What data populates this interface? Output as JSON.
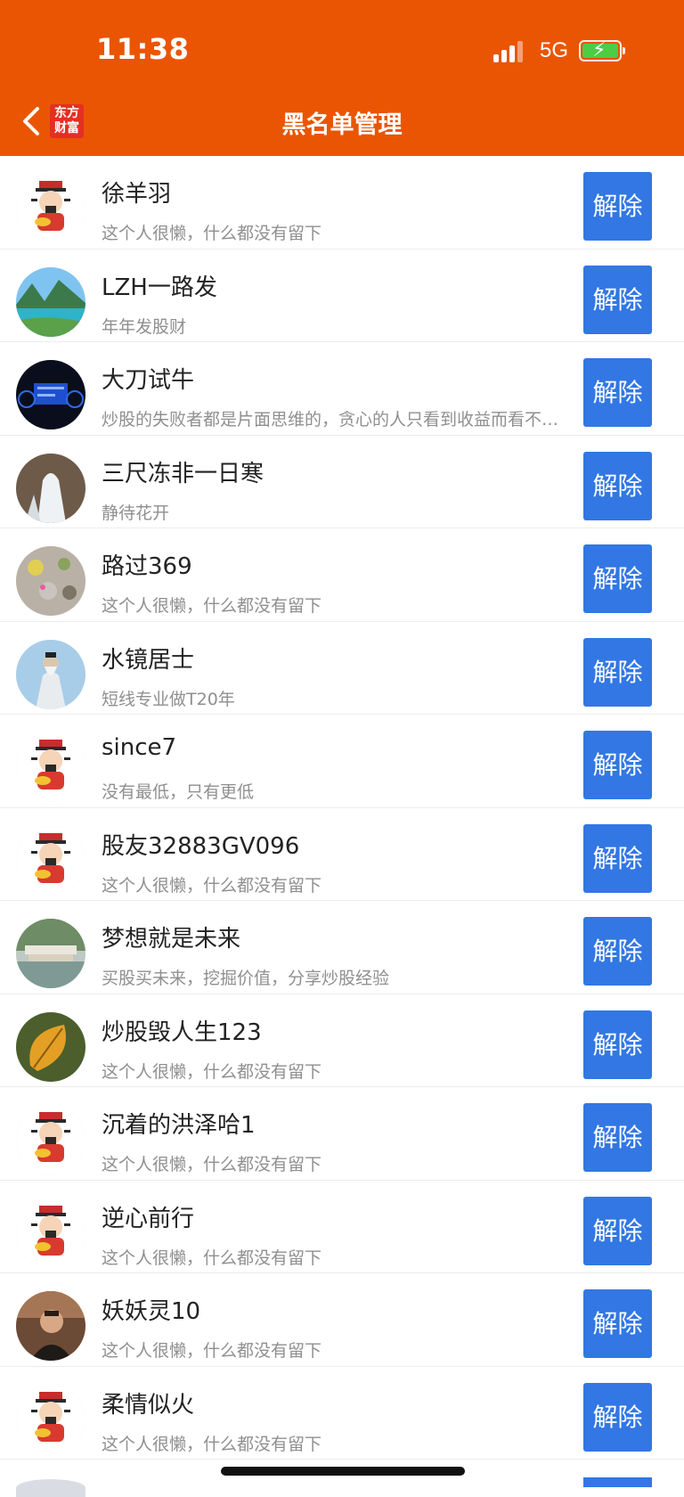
{
  "status": {
    "time": "11:38",
    "network": "5G"
  },
  "header": {
    "title": "黑名单管理",
    "logo_line1": "东方",
    "logo_line2": "财富"
  },
  "colors": {
    "header": "#ea5504",
    "button": "#3277e3",
    "battery": "#4ccd45"
  },
  "list": [
    {
      "name": "徐羊羽",
      "signature": "这个人很懒，什么都没有留下",
      "action": "解除",
      "avatar": "caishen-avatar"
    },
    {
      "name": "LZH一路发",
      "signature": "年年发股财",
      "action": "解除",
      "avatar": "lake-scenery-avatar"
    },
    {
      "name": "大刀试牛",
      "signature": "炒股的失败者都是片面思维的，贪心的人只看到收益而看不到风险",
      "action": "解除",
      "avatar": "dashboard-avatar"
    },
    {
      "name": "三尺冻非一日寒",
      "signature": "静待花开",
      "action": "解除",
      "avatar": "frozen-fountain-avatar"
    },
    {
      "name": "路过369",
      "signature": "这个人很懒，什么都没有留下",
      "action": "解除",
      "avatar": "flowers-avatar"
    },
    {
      "name": "水镜居士",
      "signature": "短线专业做T20年",
      "action": "解除",
      "avatar": "sage-avatar"
    },
    {
      "name": "since7",
      "signature": "没有最低，只有更低",
      "action": "解除",
      "avatar": "caishen-avatar"
    },
    {
      "name": "股友32883GV096",
      "signature": "这个人很懒，什么都没有留下",
      "action": "解除",
      "avatar": "caishen-avatar"
    },
    {
      "name": "梦想就是未来",
      "signature": "买股买未来，挖掘价值，分享炒股经验",
      "action": "解除",
      "avatar": "pavilion-avatar"
    },
    {
      "name": "炒股毁人生123",
      "signature": "这个人很懒，什么都没有留下",
      "action": "解除",
      "avatar": "autumn-leaf-avatar"
    },
    {
      "name": "沉着的洪泽哈1",
      "signature": "这个人很懒，什么都没有留下",
      "action": "解除",
      "avatar": "caishen-avatar"
    },
    {
      "name": "逆心前行",
      "signature": "这个人很懒，什么都没有留下",
      "action": "解除",
      "avatar": "caishen-avatar"
    },
    {
      "name": "妖妖灵10",
      "signature": "这个人很懒，什么都没有留下",
      "action": "解除",
      "avatar": "person-photo-avatar"
    },
    {
      "name": "柔情似火",
      "signature": "这个人很懒，什么都没有留下",
      "action": "解除",
      "avatar": "caishen-avatar"
    }
  ]
}
